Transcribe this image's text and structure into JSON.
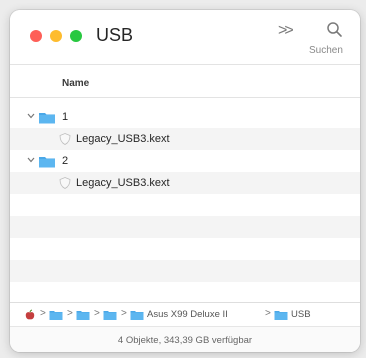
{
  "window": {
    "title": "USB"
  },
  "toolbar": {
    "more_label": ">>",
    "search_label": "Suchen"
  },
  "columns": {
    "name": "Name"
  },
  "rows": [
    {
      "type": "folder",
      "label": "1",
      "expanded": true
    },
    {
      "type": "file",
      "label": "Legacy_USB3.kext"
    },
    {
      "type": "folder",
      "label": "2",
      "expanded": true
    },
    {
      "type": "file",
      "label": "Legacy_USB3.kext"
    }
  ],
  "pathbar": {
    "sep": ">",
    "items": [
      {
        "icon": "macos-disk-icon",
        "label": ""
      },
      {
        "icon": "folder-icon",
        "label": ""
      },
      {
        "icon": "folder-icon",
        "label": ""
      },
      {
        "icon": "folder-icon",
        "label": ""
      },
      {
        "icon": "folder-icon",
        "label": "Asus X99 Deluxe II"
      },
      {
        "icon": "folder-icon",
        "label": "USB"
      }
    ]
  },
  "status": {
    "text": "4 Objekte, 343,39 GB verfügbar"
  },
  "colors": {
    "folder": "#4aa8e8",
    "red": "#fe5f57",
    "yellow": "#febc2e",
    "green": "#28c840"
  }
}
